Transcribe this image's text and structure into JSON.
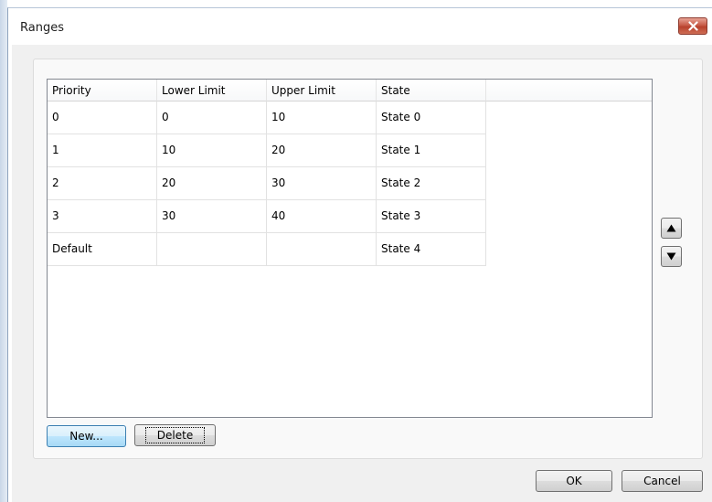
{
  "window": {
    "title": "Ranges"
  },
  "table": {
    "columns": [
      "Priority",
      "Lower Limit",
      "Upper Limit",
      "State"
    ],
    "rows": [
      [
        "0",
        "0",
        "10",
        "State 0"
      ],
      [
        "1",
        "10",
        "20",
        "State 1"
      ],
      [
        "2",
        "20",
        "30",
        "State 2"
      ],
      [
        "3",
        "30",
        "40",
        "State 3"
      ],
      [
        "Default",
        "",
        "",
        "State 4"
      ]
    ]
  },
  "buttons": {
    "new_label": "New...",
    "delete_label": "Delete",
    "ok_label": "OK",
    "cancel_label": "Cancel"
  },
  "icons": {
    "close": "close-icon",
    "move_up": "arrow-up-icon",
    "move_down": "arrow-down-icon"
  },
  "colors": {
    "close_button": "#c75b47",
    "focused_button_border": "#3c7fb1"
  }
}
